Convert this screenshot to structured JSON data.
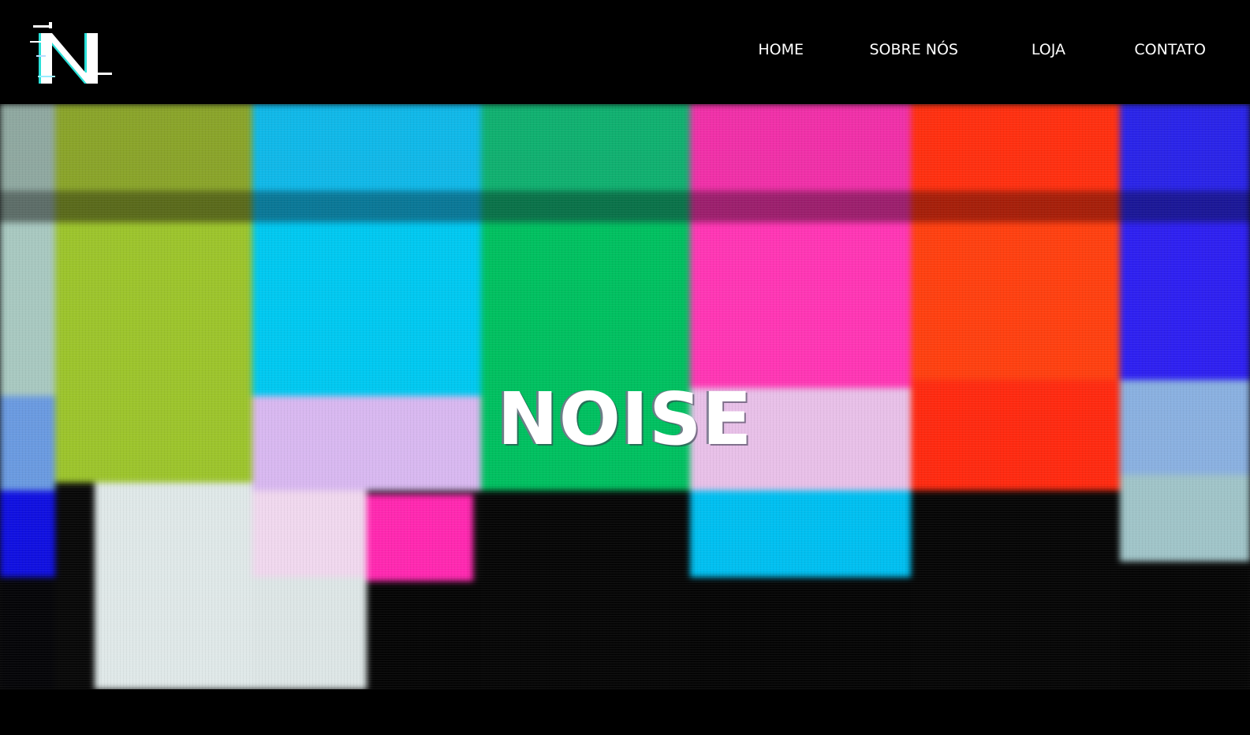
{
  "brand": {
    "logo_icon": "glitch-N-logo",
    "logo_letter": "N"
  },
  "nav": {
    "items": [
      {
        "label": "HOME"
      },
      {
        "label": "SOBRE NÓS"
      },
      {
        "label": "LOJA"
      },
      {
        "label": "CONTATO"
      }
    ]
  },
  "hero": {
    "title": "NOISE",
    "background": "color-bars-glitch",
    "colors": {
      "yellow_green": "#9bc42a",
      "cyan": "#00c8f0",
      "green": "#00c060",
      "magenta": "#ff30b0",
      "red": "#ff3010",
      "blue": "#2020f0",
      "lavender": "#d8b8f0",
      "white": "#e8f0f0",
      "black": "#080808"
    }
  }
}
